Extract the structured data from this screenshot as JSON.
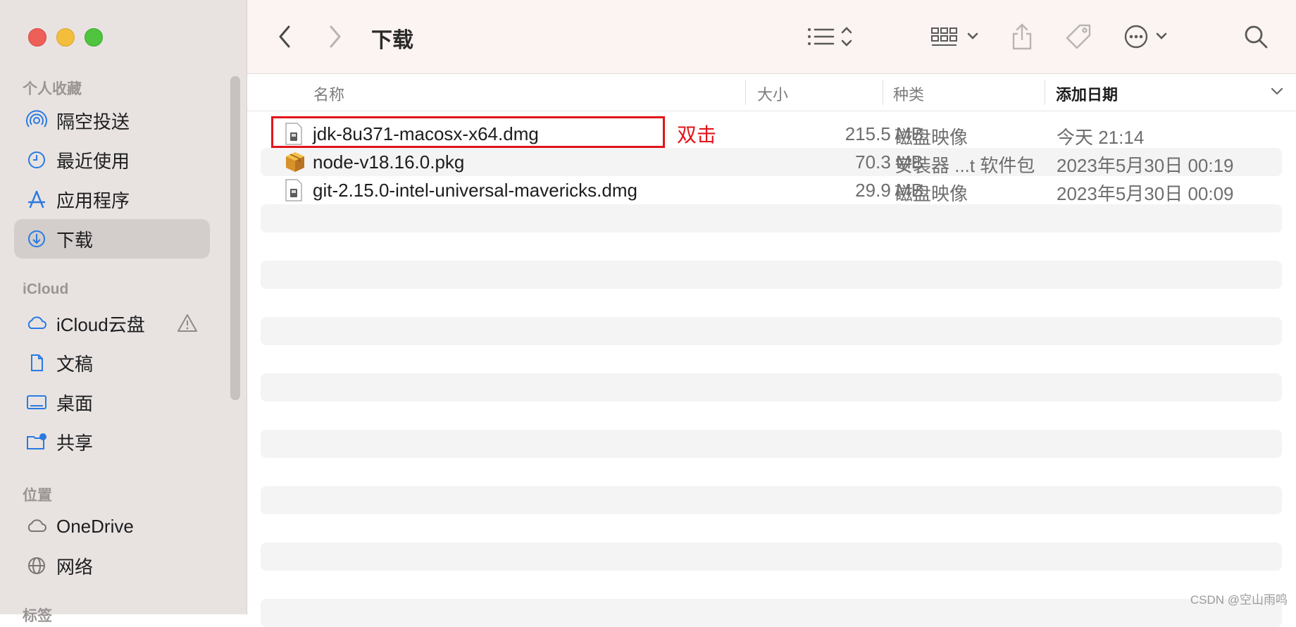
{
  "window": {
    "title": "下载"
  },
  "sidebar": {
    "sections": [
      {
        "title": "个人收藏",
        "items": [
          {
            "label": "隔空投送",
            "icon": "airdrop-icon"
          },
          {
            "label": "最近使用",
            "icon": "clock-icon"
          },
          {
            "label": "应用程序",
            "icon": "applications-icon"
          },
          {
            "label": "下载",
            "icon": "download-icon",
            "active": true
          }
        ]
      },
      {
        "title": "iCloud",
        "items": [
          {
            "label": "iCloud云盘",
            "icon": "cloud-icon",
            "warning": true
          },
          {
            "label": "文稿",
            "icon": "document-icon"
          },
          {
            "label": "桌面",
            "icon": "desktop-icon"
          },
          {
            "label": "共享",
            "icon": "shared-folder-icon"
          }
        ]
      },
      {
        "title": "位置",
        "items": [
          {
            "label": "OneDrive",
            "icon": "cloud-icon"
          },
          {
            "label": "网络",
            "icon": "network-globe-icon"
          }
        ]
      },
      {
        "title": "标签",
        "items": []
      }
    ]
  },
  "columns": {
    "name": "名称",
    "size": "大小",
    "kind": "种类",
    "date": "添加日期"
  },
  "files": [
    {
      "name": "jdk-8u371-macosx-x64.dmg",
      "size": "215.5 MB",
      "kind": "磁盘映像",
      "date": "今天 21:14",
      "icon": "disk-image-icon"
    },
    {
      "name": "node-v18.16.0.pkg",
      "size": "70.3 MB",
      "kind": "安装器 ...t 软件包",
      "date": "2023年5月30日 00:19",
      "icon": "package-icon"
    },
    {
      "name": "git-2.15.0-intel-universal-mavericks.dmg",
      "size": "29.9 MB",
      "kind": "磁盘映像",
      "date": "2023年5月30日 00:09",
      "icon": "disk-image-icon"
    }
  ],
  "annotation": {
    "text": "双击",
    "color": "#e2141a"
  },
  "watermark": "CSDN @空山雨鸣",
  "colors": {
    "accent": "#2a7ae2",
    "highlight": "#e2141a"
  }
}
